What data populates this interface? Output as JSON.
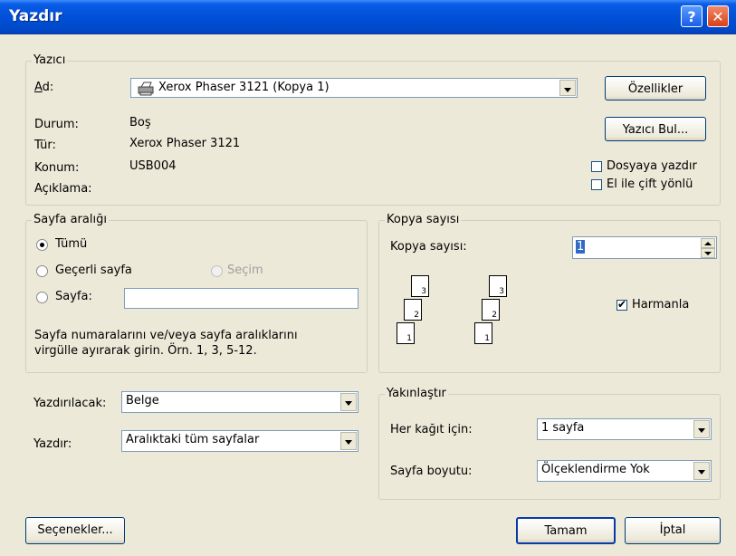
{
  "window": {
    "title": "Yazdır",
    "help_glyph": "?",
    "close_glyph": "✕"
  },
  "printer": {
    "group_label": "Yazıcı",
    "name_label": "Ad:",
    "name_value": "Xerox Phaser 3121 (Kopya 1)",
    "properties_button": "Özellikler",
    "find_printer_button": "Yazıcı Bul...",
    "status_label": "Durum:",
    "status_value": "Boş",
    "type_label": "Tür:",
    "type_value": "Xerox Phaser 3121",
    "location_label": "Konum:",
    "location_value": "USB004",
    "comment_label": "Açıklama:",
    "print_to_file": "Dosyaya yazdır",
    "print_to_file_checked": false,
    "manual_duplex": "El ile çift yönlü",
    "manual_duplex_checked": false
  },
  "page_range": {
    "group_label": "Sayfa aralığı",
    "all": "Tümü",
    "current_page": "Geçerli sayfa",
    "selection": "Seçim",
    "pages": "Sayfa:",
    "pages_value": "",
    "selected": "all",
    "help_line1": "Sayfa numaralarını ve/veya sayfa aralıklarını",
    "help_line2": "virgülle ayırarak girin. Örn. 1, 3, 5-12."
  },
  "copies": {
    "group_label": "Kopya sayısı",
    "count_label": "Kopya sayısı:",
    "count_value": "1",
    "collate": "Harmanla",
    "collate_checked": true
  },
  "print_what": {
    "label": "Yazdırılacak:",
    "value": "Belge"
  },
  "print": {
    "label": "Yazdır:",
    "value": "Aralıktaki tüm sayfalar"
  },
  "zoom": {
    "group_label": "Yakınlaştır",
    "pages_per_sheet_label": "Her kağıt için:",
    "pages_per_sheet_value": "1 sayfa",
    "scale_label": "Sayfa boyutu:",
    "scale_value": "Ölçeklendirme Yok"
  },
  "buttons": {
    "options": "Seçenekler...",
    "ok": "Tamam",
    "cancel": "İptal"
  },
  "icons": {
    "printer": "printer-icon",
    "page_numbers": [
      "3",
      "2",
      "1"
    ]
  },
  "colors": {
    "titlebar": "#0050d8",
    "dialog": "#ece9d8",
    "close": "#d8401a"
  }
}
